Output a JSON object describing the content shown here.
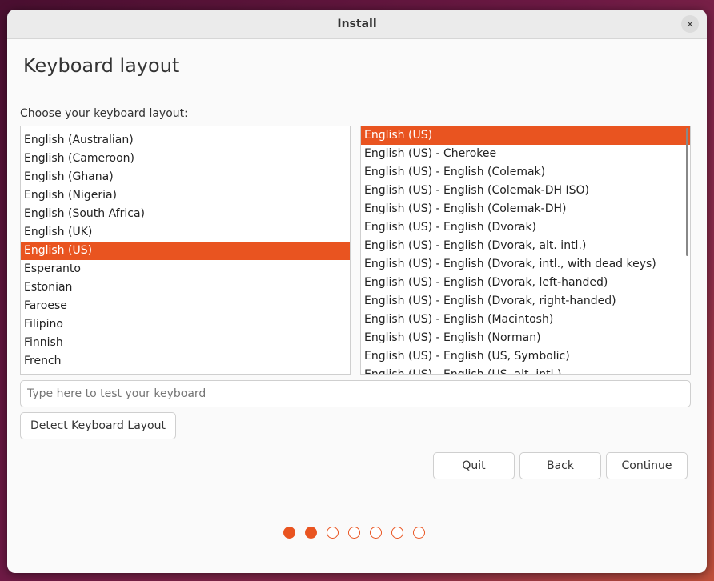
{
  "window": {
    "title": "Install",
    "close_icon": "×"
  },
  "page": {
    "heading": "Keyboard layout",
    "prompt": "Choose your keyboard layout:"
  },
  "layouts": [
    "English (Australian)",
    "English (Cameroon)",
    "English (Ghana)",
    "English (Nigeria)",
    "English (South Africa)",
    "English (UK)",
    "English (US)",
    "Esperanto",
    "Estonian",
    "Faroese",
    "Filipino",
    "Finnish",
    "French"
  ],
  "selected_layout": "English (US)",
  "variants": [
    "English (US)",
    "English (US) - Cherokee",
    "English (US) - English (Colemak)",
    "English (US) - English (Colemak-DH ISO)",
    "English (US) - English (Colemak-DH)",
    "English (US) - English (Dvorak)",
    "English (US) - English (Dvorak, alt. intl.)",
    "English (US) - English (Dvorak, intl., with dead keys)",
    "English (US) - English (Dvorak, left-handed)",
    "English (US) - English (Dvorak, right-handed)",
    "English (US) - English (Macintosh)",
    "English (US) - English (Norman)",
    "English (US) - English (US, Symbolic)",
    "English (US) - English (US, alt. intl.)"
  ],
  "selected_variant": "English (US)",
  "test_input": {
    "value": "",
    "placeholder": "Type here to test your keyboard"
  },
  "buttons": {
    "detect": "Detect Keyboard Layout",
    "quit": "Quit",
    "back": "Back",
    "continue": "Continue"
  },
  "progress": {
    "current_step": 2,
    "total_steps": 7
  },
  "colors": {
    "accent": "#e95420"
  }
}
